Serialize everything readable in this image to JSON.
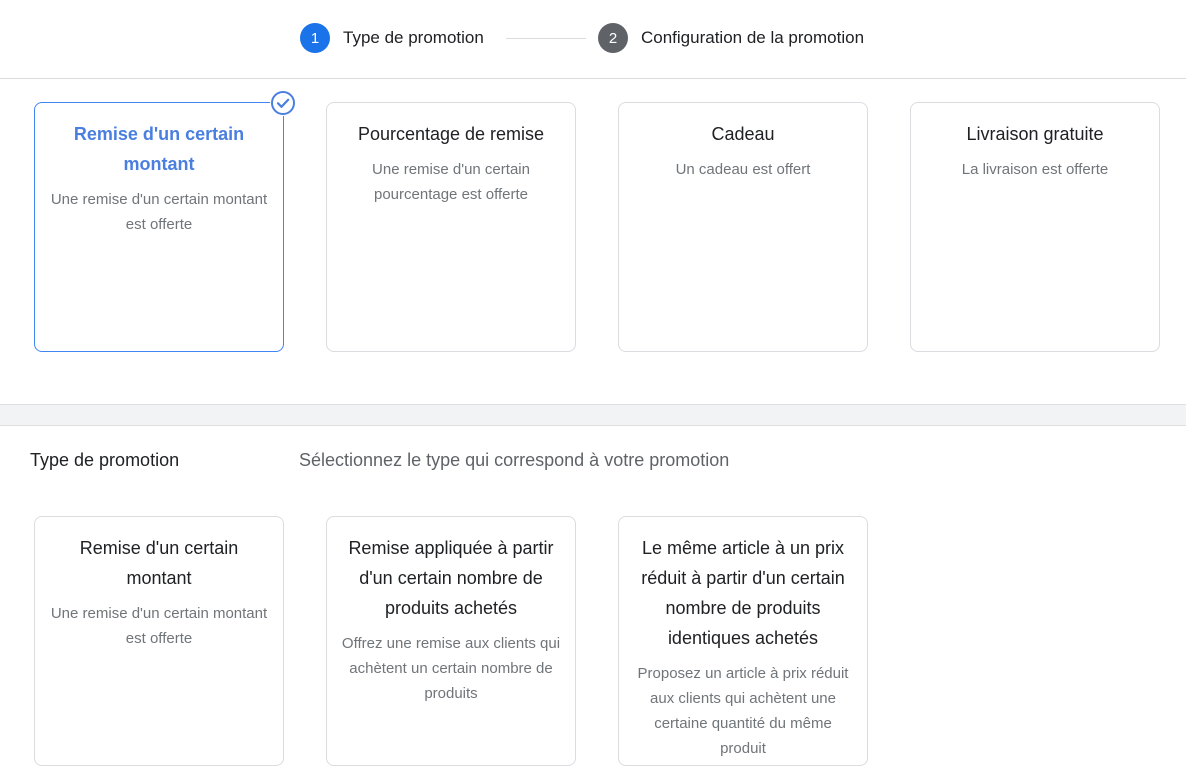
{
  "colors": {
    "accent": "#1a73e8",
    "step_inactive": "#5f6368",
    "selected_border": "#4285f4"
  },
  "stepper": {
    "steps": [
      {
        "number": "1",
        "label": "Type de promotion",
        "state": "active"
      },
      {
        "number": "2",
        "label": "Configuration de la promotion",
        "state": "inactive"
      }
    ]
  },
  "top_cards": [
    {
      "title": "Remise d'un certain montant",
      "desc": "Une remise d'un certain montant est offerte",
      "selected": true,
      "icon": "check-circle-icon"
    },
    {
      "title": "Pourcentage de remise",
      "desc": "Une remise d'un certain pourcentage est offerte",
      "selected": false
    },
    {
      "title": "Cadeau",
      "desc": "Un cadeau est offert",
      "selected": false
    },
    {
      "title": "Livraison gratuite",
      "desc": "La livraison est offerte",
      "selected": false
    }
  ],
  "section": {
    "label": "Type de promotion",
    "description": "Sélectionnez le type qui correspond à votre promotion"
  },
  "bottom_cards": [
    {
      "title": "Remise d'un certain montant",
      "desc": "Une remise d'un certain montant est offerte"
    },
    {
      "title": "Remise appliquée à partir d'un certain nombre de produits achetés",
      "desc": "Offrez une remise aux clients qui achètent un certain nombre de produits"
    },
    {
      "title": "Le même article à un prix réduit à partir d'un certain nombre de produits identiques achetés",
      "desc": "Proposez un article à prix réduit aux clients qui achètent une certaine quantité du même produit"
    }
  ]
}
